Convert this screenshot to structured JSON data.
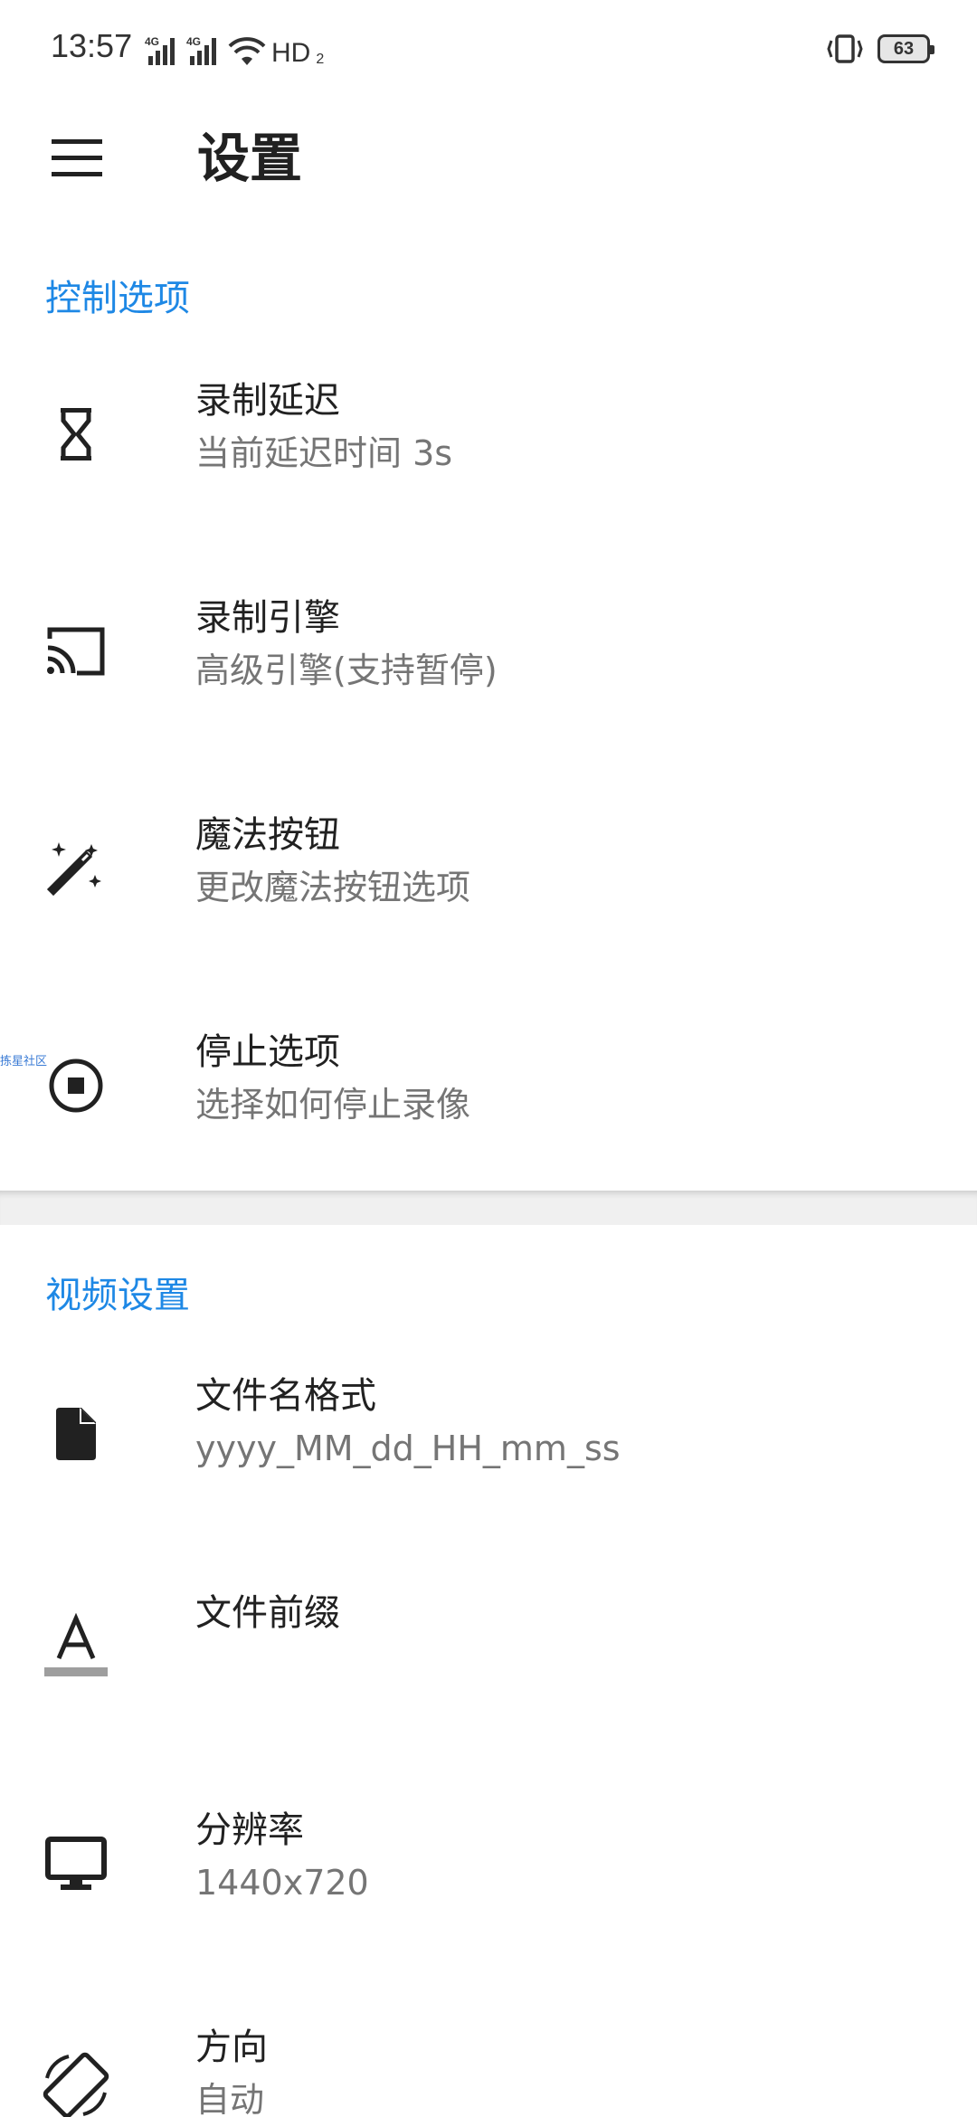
{
  "status_bar": {
    "time": "13:57",
    "net1": "4G",
    "net2": "4G",
    "hd": "HD",
    "hd_sub": "2",
    "battery": "63"
  },
  "app_bar": {
    "title": "设置",
    "menu_icon": "hamburger-menu-icon"
  },
  "sections": {
    "control": {
      "header": "控制选项",
      "items": [
        {
          "title": "录制延迟",
          "summary": "当前延迟时间 3s",
          "icon": "hourglass-icon"
        },
        {
          "title": "录制引擎",
          "summary": "高级引擎(支持暂停)",
          "icon": "cast-icon"
        },
        {
          "title": "魔法按钮",
          "summary": "更改魔法按钮选项",
          "icon": "magic-wand-icon"
        },
        {
          "title": "停止选项",
          "summary": "选择如何停止录像",
          "icon": "stop-circle-icon"
        }
      ]
    },
    "video": {
      "header": "视频设置",
      "items": [
        {
          "title": "文件名格式",
          "summary": "yyyy_MM_dd_HH_mm_ss",
          "icon": "file-icon"
        },
        {
          "title": "文件前缀",
          "summary": "",
          "icon": "text-format-icon"
        },
        {
          "title": "分辨率",
          "summary": "1440x720",
          "icon": "monitor-icon"
        },
        {
          "title": "方向",
          "summary": "自动",
          "icon": "screen-rotation-icon"
        }
      ]
    }
  },
  "watermark": "拣星社区",
  "colors": {
    "accent": "#1e88e5",
    "title_text": "#212121",
    "summary_text": "#757575",
    "divider": "#f0f0f0"
  }
}
